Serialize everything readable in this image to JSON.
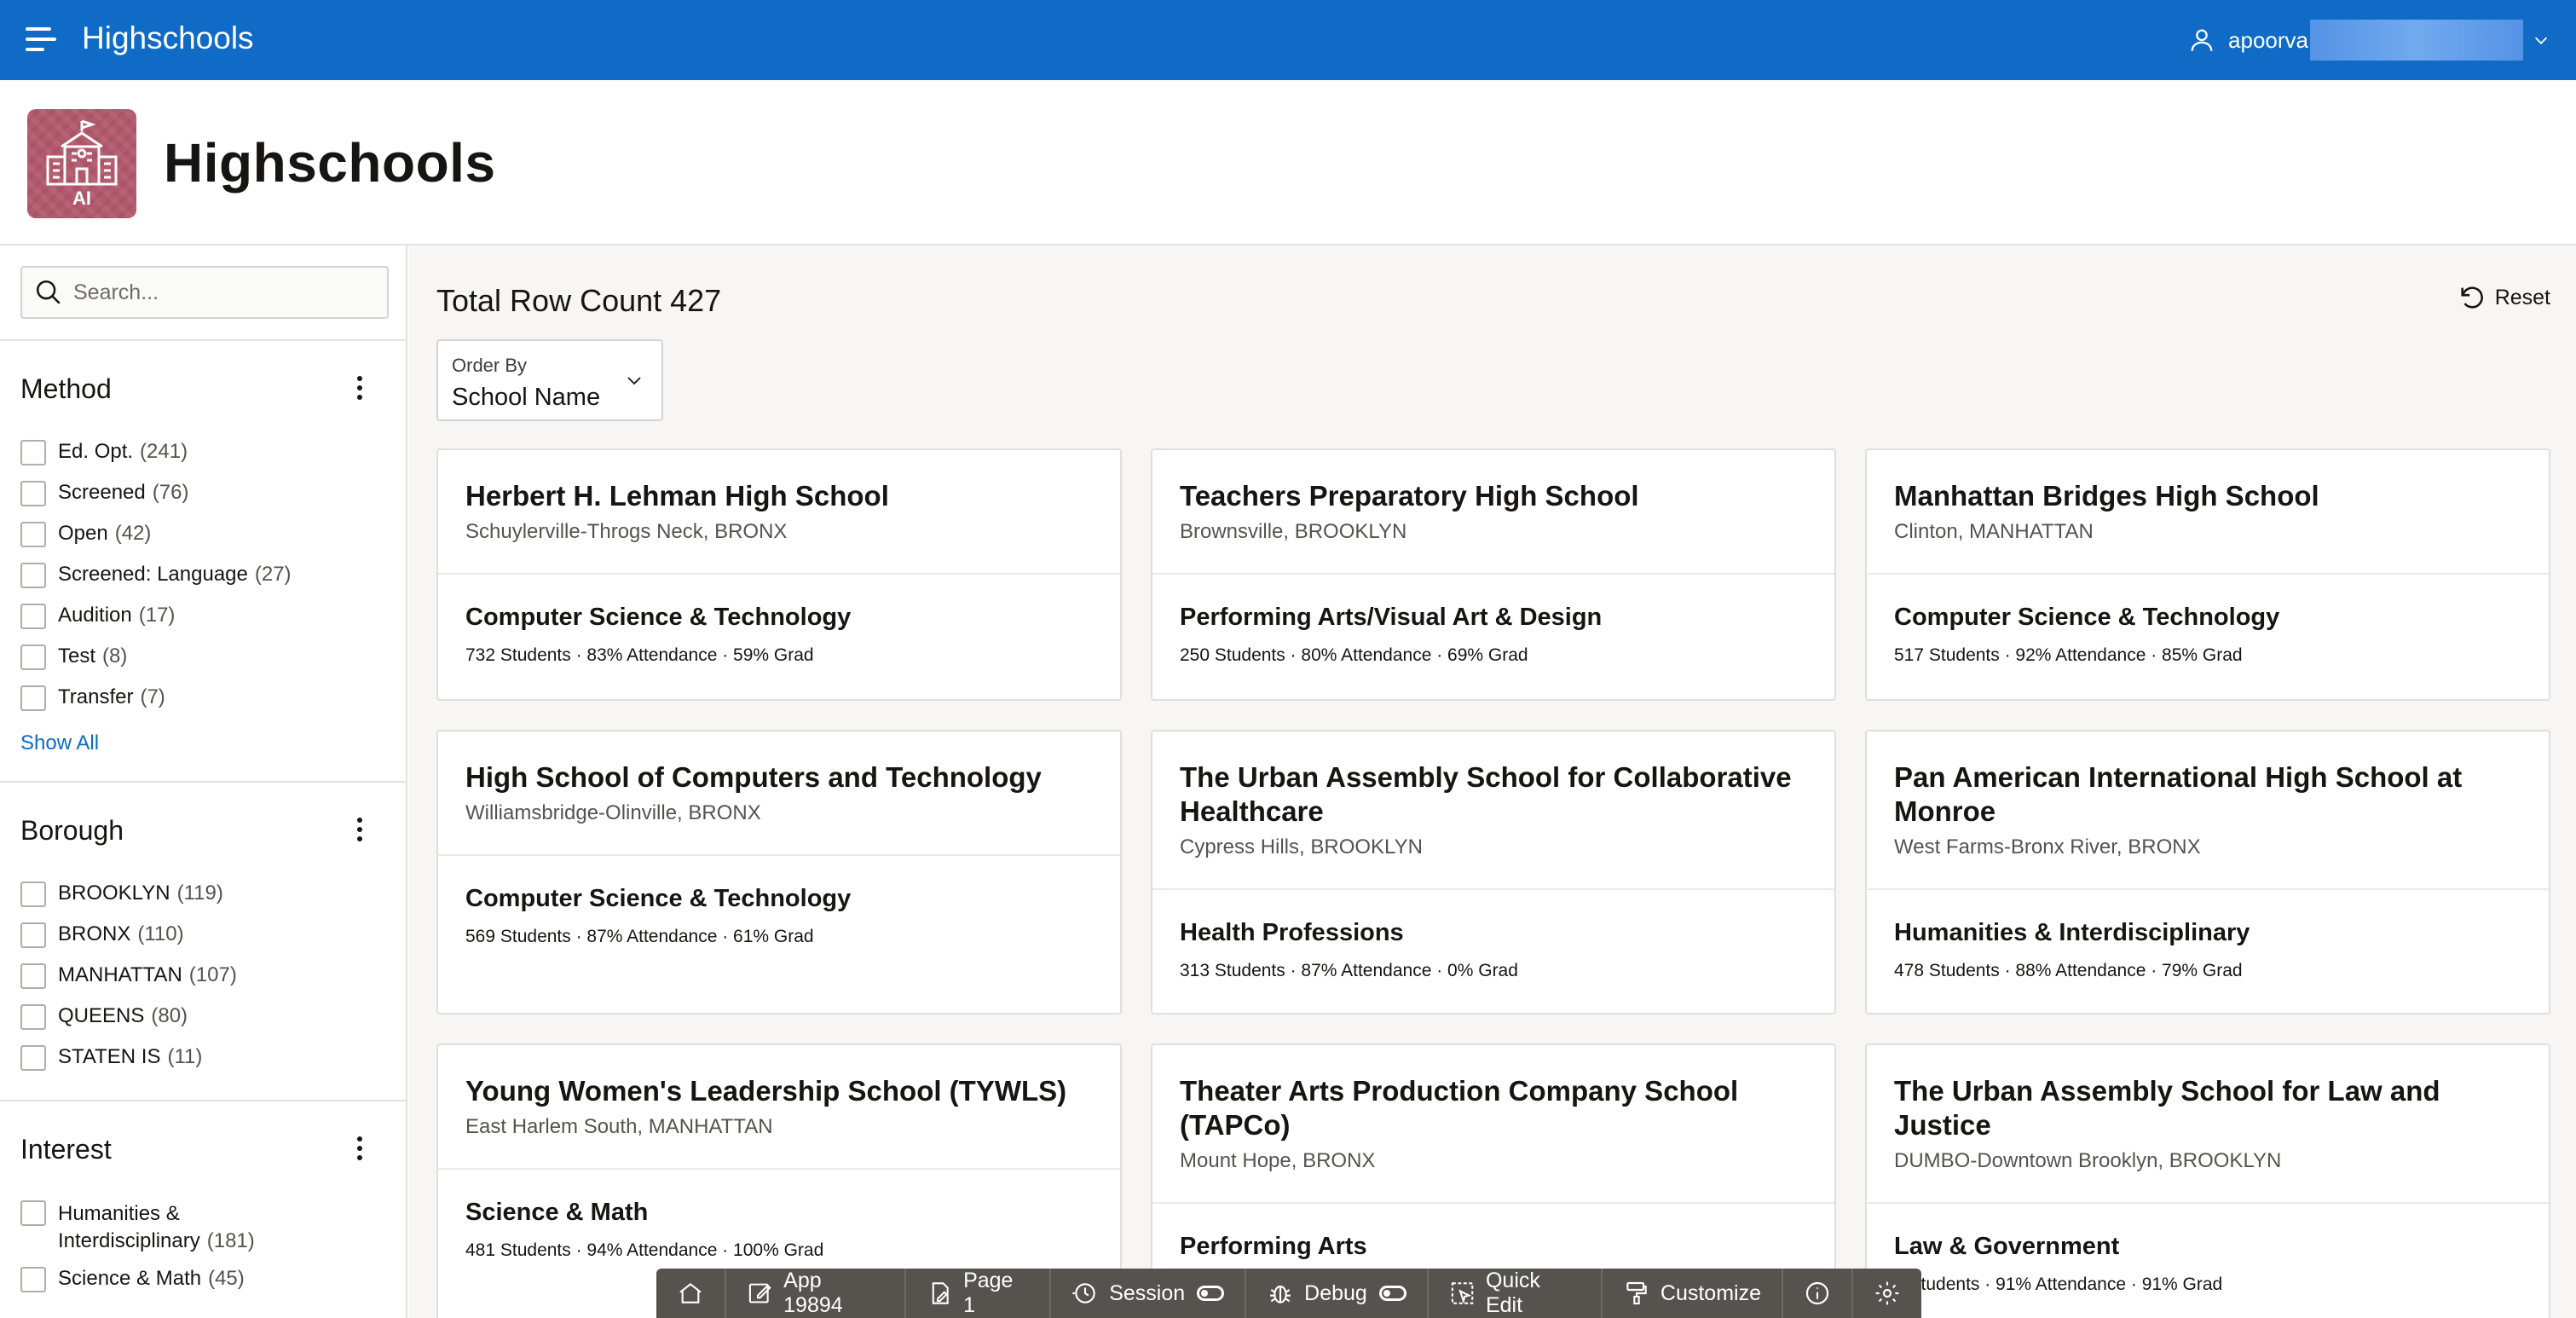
{
  "topbar": {
    "app_title": "Highschools",
    "user_name": "apoorva"
  },
  "header": {
    "page_title": "Highschools",
    "logo_text": "AI"
  },
  "sidebar": {
    "search_placeholder": "Search...",
    "facets": [
      {
        "title": "Method",
        "items": [
          {
            "label": "Ed. Opt.",
            "count": "(241)"
          },
          {
            "label": "Screened",
            "count": "(76)"
          },
          {
            "label": "Open",
            "count": "(42)"
          },
          {
            "label": "Screened: Language",
            "count": "(27)"
          },
          {
            "label": "Audition",
            "count": "(17)"
          },
          {
            "label": "Test",
            "count": "(8)"
          },
          {
            "label": "Transfer",
            "count": "(7)"
          }
        ],
        "show_all": "Show All"
      },
      {
        "title": "Borough",
        "items": [
          {
            "label": "BROOKLYN",
            "count": "(119)"
          },
          {
            "label": "BRONX",
            "count": "(110)"
          },
          {
            "label": "MANHATTAN",
            "count": "(107)"
          },
          {
            "label": "QUEENS",
            "count": "(80)"
          },
          {
            "label": "STATEN IS",
            "count": "(11)"
          }
        ]
      },
      {
        "title": "Interest",
        "items": [
          {
            "label": "Humanities & Interdisciplinary",
            "count": "(181)"
          },
          {
            "label": "Science & Math",
            "count": "(45)"
          }
        ]
      }
    ]
  },
  "main": {
    "row_count": "Total Row Count 427",
    "reset_label": "Reset",
    "order_by_label": "Order By",
    "order_by_value": "School Name",
    "cards": [
      {
        "name": "Herbert H. Lehman High School",
        "location": "Schuylerville-Throgs Neck, BRONX",
        "interest": "Computer Science & Technology",
        "stats": "732 Students · 83% Attendance · 59% Grad"
      },
      {
        "name": "Teachers Preparatory High School",
        "location": "Brownsville, BROOKLYN",
        "interest": "Performing Arts/Visual Art & Design",
        "stats": "250 Students · 80% Attendance · 69% Grad"
      },
      {
        "name": "Manhattan Bridges High School",
        "location": "Clinton, MANHATTAN",
        "interest": "Computer Science & Technology",
        "stats": "517 Students · 92% Attendance · 85% Grad"
      },
      {
        "name": "High School of Computers and Technology",
        "location": "Williamsbridge-Olinville, BRONX",
        "interest": "Computer Science & Technology",
        "stats": "569 Students · 87% Attendance · 61% Grad"
      },
      {
        "name": "The Urban Assembly School for Collaborative Healthcare",
        "location": "Cypress Hills, BROOKLYN",
        "interest": "Health Professions",
        "stats": "313 Students · 87% Attendance · 0% Grad"
      },
      {
        "name": "Pan American International High School at Monroe",
        "location": "West Farms-Bronx River, BRONX",
        "interest": "Humanities & Interdisciplinary",
        "stats": "478 Students · 88% Attendance · 79% Grad"
      },
      {
        "name": "Young Women's Leadership School (TYWLS)",
        "location": "East Harlem South, MANHATTAN",
        "interest": "Science & Math",
        "stats": "481 Students · 94% Attendance · 100% Grad"
      },
      {
        "name": "Theater Arts Production Company School (TAPCo)",
        "location": "Mount Hope, BRONX",
        "interest": "Performing Arts",
        "stats": ""
      },
      {
        "name": "The Urban Assembly School for Law and Justice",
        "location": "DUMBO-Downtown Brooklyn, BROOKLYN",
        "interest": "Law & Government",
        "stats": "9 Students · 91% Attendance · 91% Grad"
      }
    ]
  },
  "devbar": {
    "app": "App 19894",
    "page": "Page 1",
    "session": "Session",
    "debug": "Debug",
    "quick_edit": "Quick Edit",
    "customize": "Customize"
  }
}
